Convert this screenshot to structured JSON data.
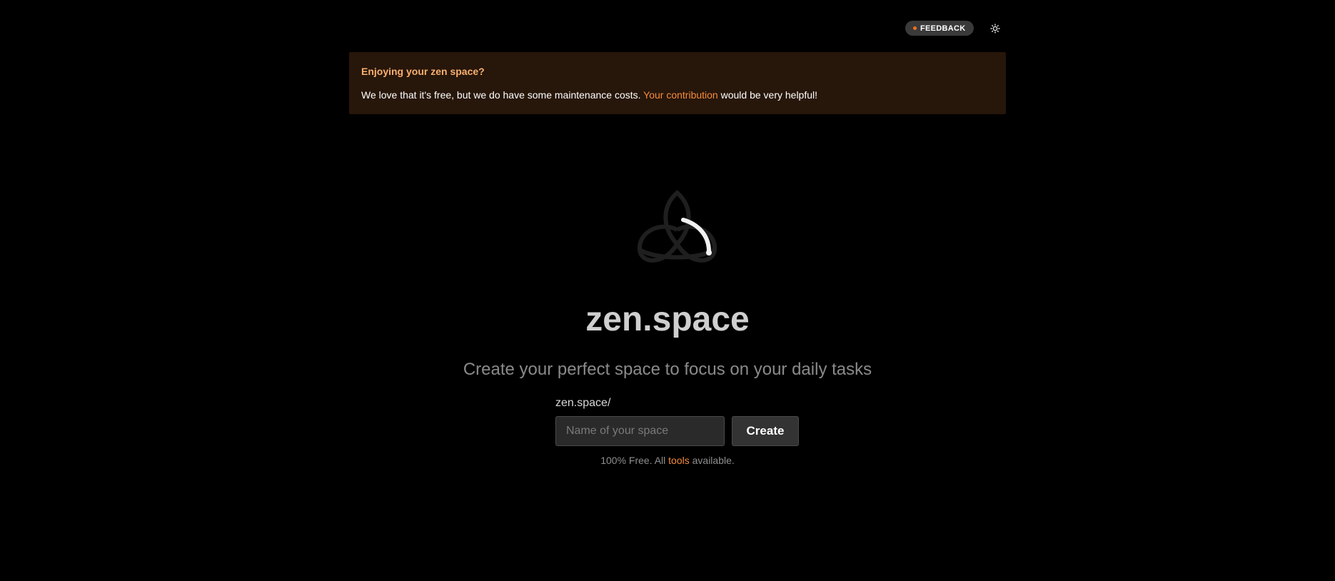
{
  "header": {
    "feedback_label": "FEEDBACK",
    "theme_toggle_icon": "sun-icon"
  },
  "banner": {
    "title": "Enjoying your zen space?",
    "text_before": "We love that it's free, but we do have some maintenance costs. ",
    "link_text": "Your contribution",
    "text_after": " would be very helpful!"
  },
  "hero": {
    "logo_icon": "triquetra-loading-icon",
    "title": "zen.space",
    "tagline": "Create your perfect space to focus on your daily tasks"
  },
  "form": {
    "prefix": "zen.space/",
    "input_value": "",
    "input_placeholder": "Name of your space",
    "create_label": "Create"
  },
  "footnote": {
    "before": "100% Free. All ",
    "link": "tools",
    "after": " available."
  },
  "colors": {
    "background": "#000000",
    "accent": "#f58c3c",
    "banner_bg": "#27160a",
    "banner_title": "#f9b071"
  }
}
